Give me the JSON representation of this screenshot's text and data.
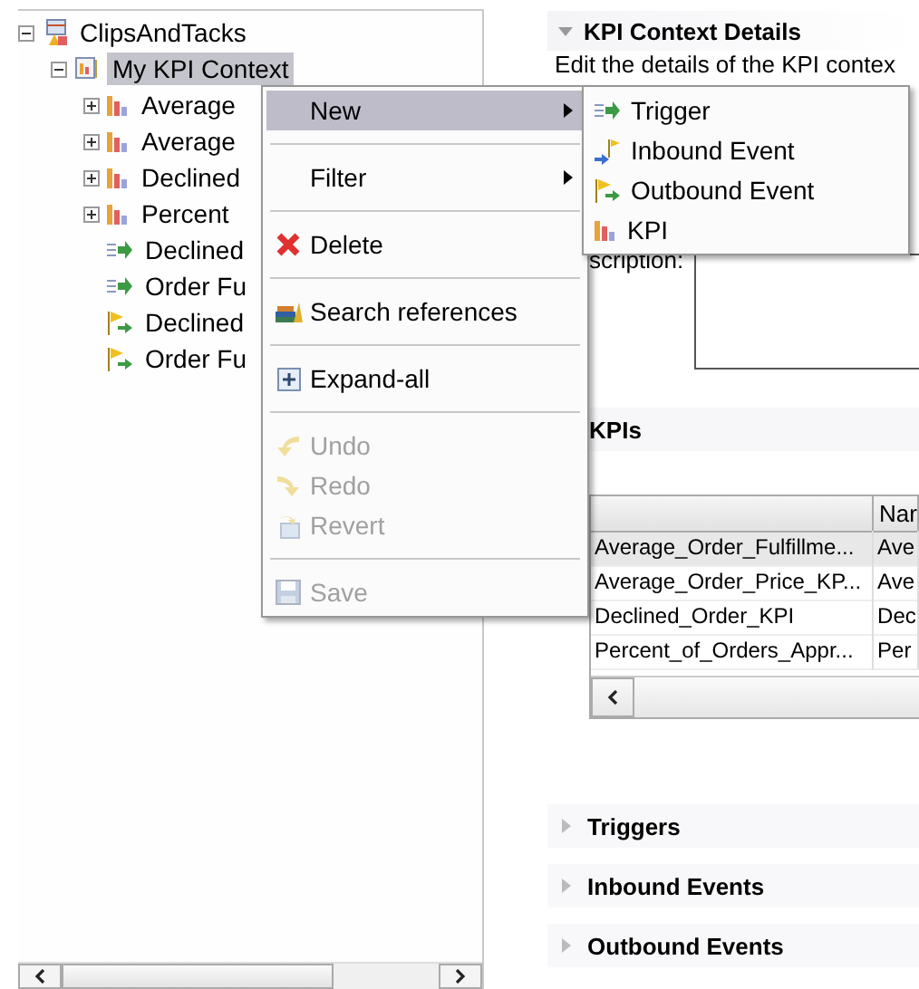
{
  "tree": [
    {
      "label": "ClipsAndTacks",
      "kind": "project",
      "expanded": true,
      "selected": false,
      "children": [
        {
          "label": "My KPI Context",
          "kind": "context",
          "expanded": true,
          "selected": true,
          "children": [
            {
              "label": "Average",
              "kind": "kpi",
              "expanded": false,
              "selected": false
            },
            {
              "label": "Average",
              "kind": "kpi",
              "expanded": false,
              "selected": false
            },
            {
              "label": "Declined",
              "kind": "kpi",
              "expanded": false,
              "selected": false
            },
            {
              "label": "Percent",
              "kind": "kpi",
              "expanded": false,
              "selected": false
            },
            {
              "label": "Declined",
              "kind": "trigger",
              "selected": false
            },
            {
              "label": "Order Fu",
              "kind": "trigger",
              "selected": false
            },
            {
              "label": "Declined",
              "kind": "outbound",
              "selected": false
            },
            {
              "label": "Order Fu",
              "kind": "outbound",
              "selected": false
            }
          ]
        }
      ]
    }
  ],
  "context_menu": [
    {
      "label": "New",
      "kind": "none",
      "submenu": true,
      "selected": true,
      "disabled": false
    },
    {
      "kind": "separator"
    },
    {
      "label": "Filter",
      "kind": "none",
      "submenu": true,
      "selected": false,
      "disabled": false
    },
    {
      "kind": "separator"
    },
    {
      "label": "Delete",
      "kind": "delete",
      "submenu": false,
      "selected": false,
      "disabled": false
    },
    {
      "kind": "separator"
    },
    {
      "label": "Search references",
      "kind": "search",
      "submenu": false,
      "selected": false,
      "disabled": false
    },
    {
      "kind": "separator"
    },
    {
      "label": "Expand-all",
      "kind": "expand",
      "submenu": false,
      "selected": false,
      "disabled": false
    },
    {
      "kind": "separator"
    },
    {
      "label": "Undo",
      "kind": "undo",
      "submenu": false,
      "selected": false,
      "disabled": true
    },
    {
      "label": "Redo",
      "kind": "redo",
      "submenu": false,
      "selected": false,
      "disabled": true
    },
    {
      "label": "Revert",
      "kind": "revert",
      "submenu": false,
      "selected": false,
      "disabled": true
    },
    {
      "kind": "separator"
    },
    {
      "label": "Save",
      "kind": "save",
      "submenu": false,
      "selected": false,
      "disabled": true
    }
  ],
  "submenu": [
    {
      "label": "Trigger",
      "kind": "trigger"
    },
    {
      "label": "Inbound Event",
      "kind": "inbound"
    },
    {
      "label": "Outbound Event",
      "kind": "outbound"
    },
    {
      "label": "KPI",
      "kind": "kpi"
    }
  ],
  "details": {
    "title": "KPI Context Details",
    "expanded": true,
    "text": "Edit the details of the KPI contex",
    "description_label": "scription:"
  },
  "kpis": {
    "title": "KPIs",
    "columns": [
      {},
      {
        "label": "Nar"
      }
    ],
    "rows": [
      {
        "cells": [
          "Average_Order_Fulfillme...",
          "Ave"
        ],
        "selected": true
      },
      {
        "cells": [
          "Average_Order_Price_KP...",
          "Ave"
        ],
        "selected": false
      },
      {
        "cells": [
          "Declined_Order_KPI",
          "Dec"
        ],
        "selected": false
      },
      {
        "cells": [
          "Percent_of_Orders_Appr...",
          "Per"
        ],
        "selected": false
      }
    ]
  },
  "sections": [
    {
      "title": "Triggers",
      "expanded": false
    },
    {
      "title": "Inbound Events",
      "expanded": false
    },
    {
      "title": "Outbound Events",
      "expanded": false
    }
  ]
}
